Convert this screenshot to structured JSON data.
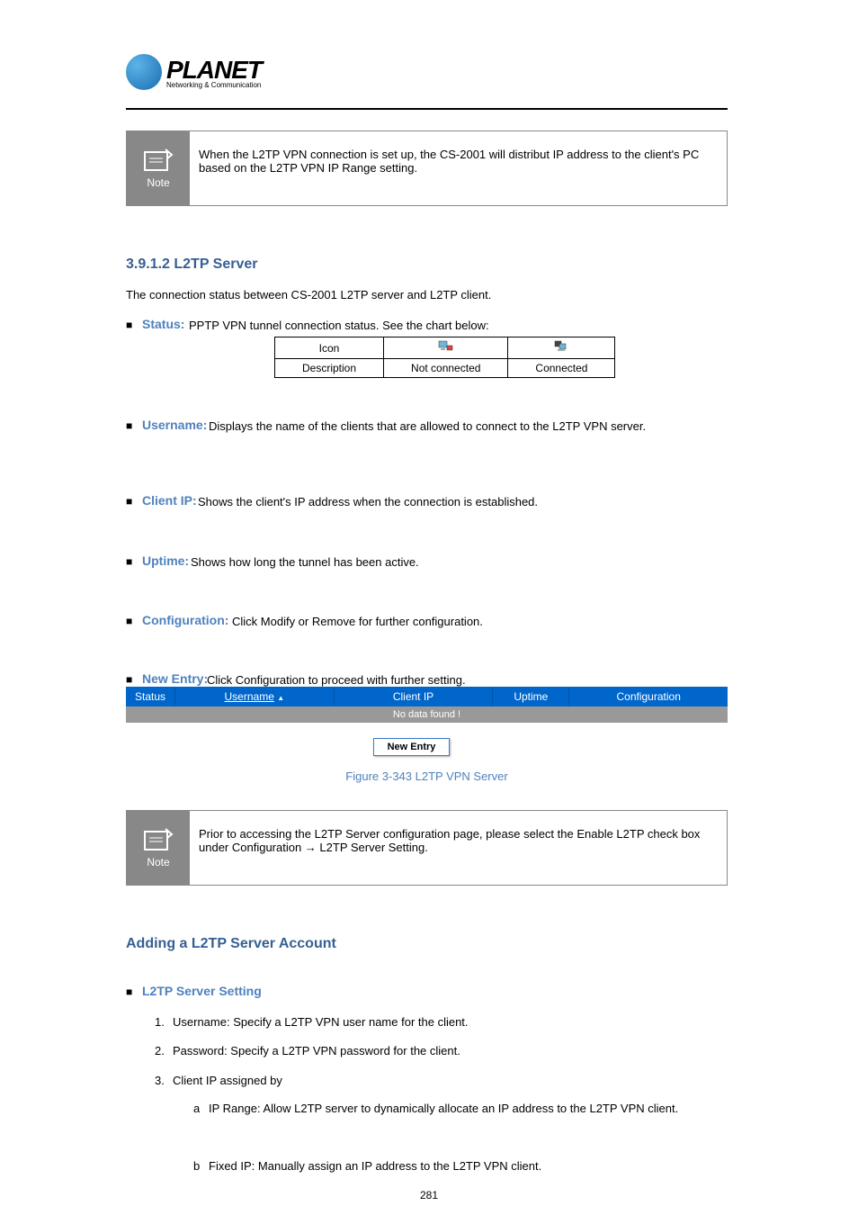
{
  "logo": {
    "brand": "PLANET",
    "tagline": "Networking & Communication"
  },
  "note1": {
    "label": "Note",
    "text": "When the L2TP VPN connection is set up, the CS-2001 will distribut IP address to the client's PC based on the L2TP VPN IP Range setting."
  },
  "section1": {
    "title": "3.9.1.2 L2TP Server",
    "desc": "The connection status between CS-2001 L2TP server and L2TP client.",
    "status_bullet": "■",
    "status_label": "Status:",
    "status_text": "PPTP VPN tunnel connection status. See the chart below:",
    "table": {
      "h1": "Icon",
      "h2_alt": "disconnected",
      "h3_alt": "connected",
      "d1": "Description",
      "d2": "Not connected",
      "d3": "Connected"
    },
    "username_bullet": "■",
    "username_label": "Username:",
    "username_text": "Displays the name of the clients that are allowed to connect to the L2TP VPN server.",
    "clientip_bullet": "■",
    "clientip_label": "Client IP:",
    "clientip_text": "Shows the client's IP address when the connection is established.",
    "uptime_bullet": "■",
    "uptime_label": "Uptime:",
    "uptime_text": "Shows how long the tunnel has been active.",
    "config_bullet": "■",
    "config_label": "Configuration:",
    "config_text": "Click Modify or Remove for further configuration.",
    "new_bullet": "■",
    "new_label": "New Entry:",
    "new_text": "Click Configuration to proceed with further setting."
  },
  "blue_table": {
    "h_status": "Status",
    "h_username": "Username",
    "h_clientip": "Client IP",
    "h_uptime": "Uptime",
    "h_config": "Configuration",
    "no_data": "No data found !",
    "button": "New Entry"
  },
  "figure1": "Figure 3-343 L2TP VPN Server",
  "note2": {
    "label": "Note",
    "text": "Prior to accessing the L2TP Server configuration page, please select the Enable L2TP check box under Configuration → L2TP Server Setting."
  },
  "section2": {
    "title": "Adding a L2TP Server Account",
    "bullet": "■",
    "main_label": "L2TP Server Setting",
    "sub1_bullet": "1.",
    "sub1_text": "Username: Specify a L2TP VPN user name for the client.",
    "sub2_bullet": "2.",
    "sub2_text": "Password: Specify a L2TP VPN password for the client.",
    "sub3_bullet": "3.",
    "sub3_text": "Client IP assigned by",
    "sub3a_bullet": "a",
    "sub3a_text": "IP Range: Allow L2TP server to dynamically allocate an IP address to the L2TP VPN client.",
    "sub3b_bullet": "b",
    "sub3b_text": "Fixed IP: Manually assign an IP address to the L2TP VPN client."
  },
  "page_num": "281"
}
